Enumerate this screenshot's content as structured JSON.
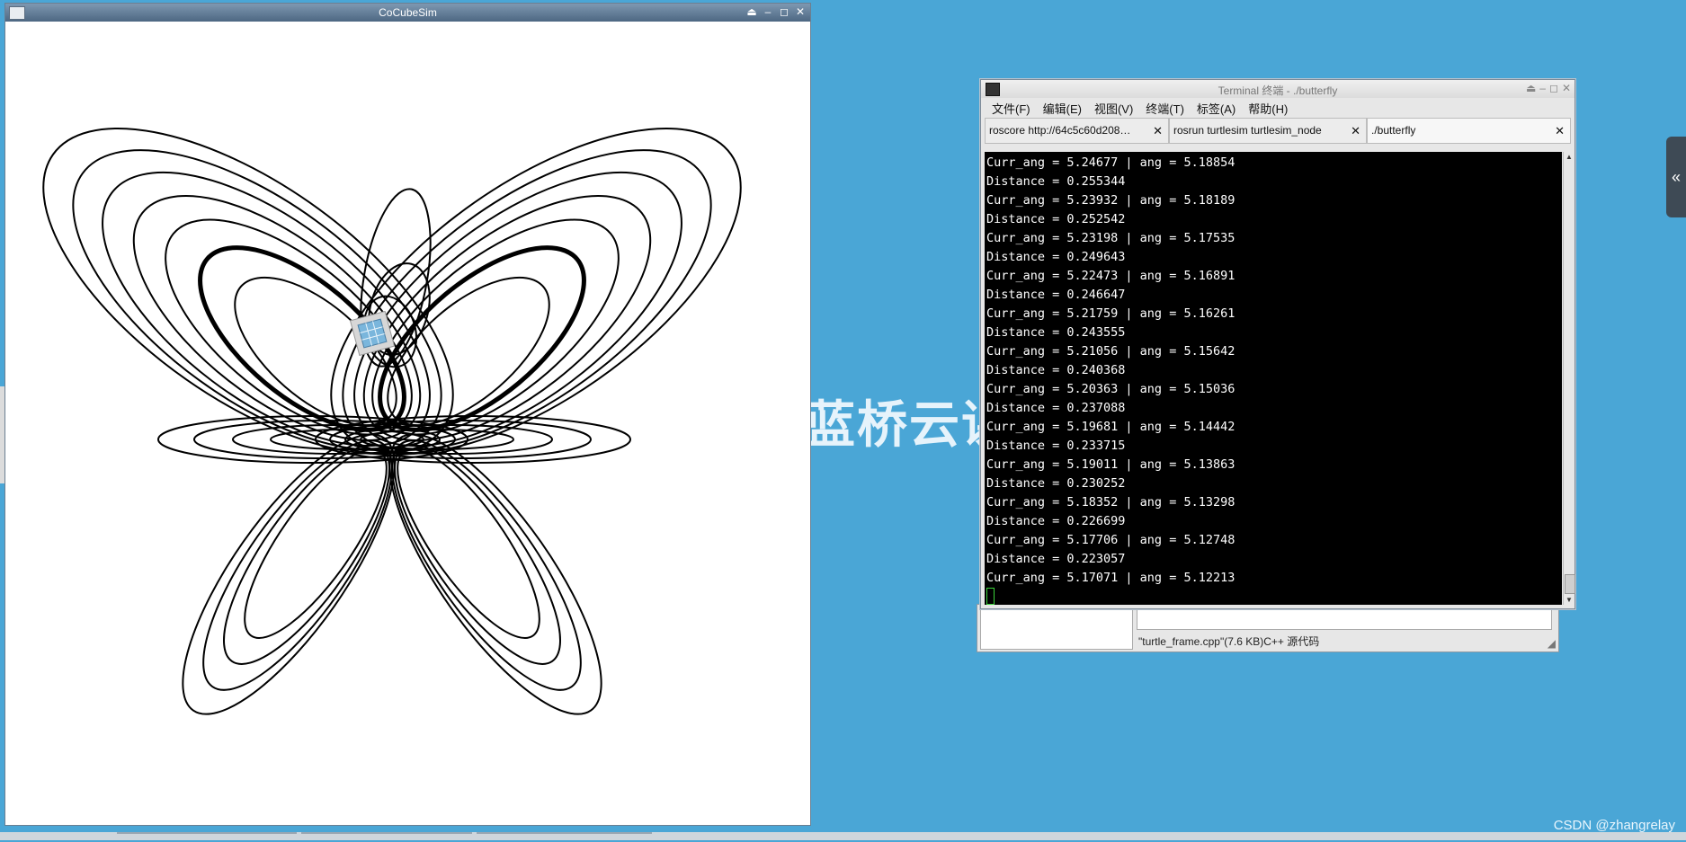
{
  "desktop": {
    "watermark": "蓝桥云课",
    "csdn_credit": "CSDN @zhangrelay",
    "left_tab_icon": "chevron-right-icon",
    "right_tab_icon": "double-chevron-left-icon",
    "colors": {
      "background": "#4aa6d6",
      "terminal_bg": "#000000",
      "terminal_fg": "#ffffff"
    }
  },
  "sim_window": {
    "title": "CoCubeSim",
    "buttons": [
      "⏏",
      "–",
      "◻",
      "✕"
    ],
    "robot_icon": "robot-icon"
  },
  "terminal": {
    "title": "Terminal 终端 - ./butterfly",
    "menu": [
      "文件(F)",
      "编辑(E)",
      "视图(V)",
      "终端(T)",
      "标签(A)",
      "帮助(H)"
    ],
    "tabs": [
      {
        "label": "roscore http://64c5c60d208…",
        "active": false
      },
      {
        "label": "rosrun turtlesim turtlesim_node",
        "active": false
      },
      {
        "label": "./butterfly",
        "active": true
      }
    ],
    "lines": [
      "Curr_ang = 5.24677 | ang = 5.18854",
      "Distance = 0.255344",
      "Curr_ang = 5.23932 | ang = 5.18189",
      "Distance = 0.252542",
      "Curr_ang = 5.23198 | ang = 5.17535",
      "Distance = 0.249643",
      "Curr_ang = 5.22473 | ang = 5.16891",
      "Distance = 0.246647",
      "Curr_ang = 5.21759 | ang = 5.16261",
      "Distance = 0.243555",
      "Curr_ang = 5.21056 | ang = 5.15642",
      "Distance = 0.240368",
      "Curr_ang = 5.20363 | ang = 5.15036",
      "Distance = 0.237088",
      "Curr_ang = 5.19681 | ang = 5.14442",
      "Distance = 0.233715",
      "Curr_ang = 5.19011 | ang = 5.13863",
      "Distance = 0.230252",
      "Curr_ang = 5.18352 | ang = 5.13298",
      "Distance = 0.226699",
      "Curr_ang = 5.17706 | ang = 5.12748",
      "Distance = 0.223057",
      "Curr_ang = 5.17071 | ang = 5.12213"
    ]
  },
  "editor": {
    "status": "\"turtle_frame.cpp\"(7.6 KB)C++ 源代码"
  }
}
